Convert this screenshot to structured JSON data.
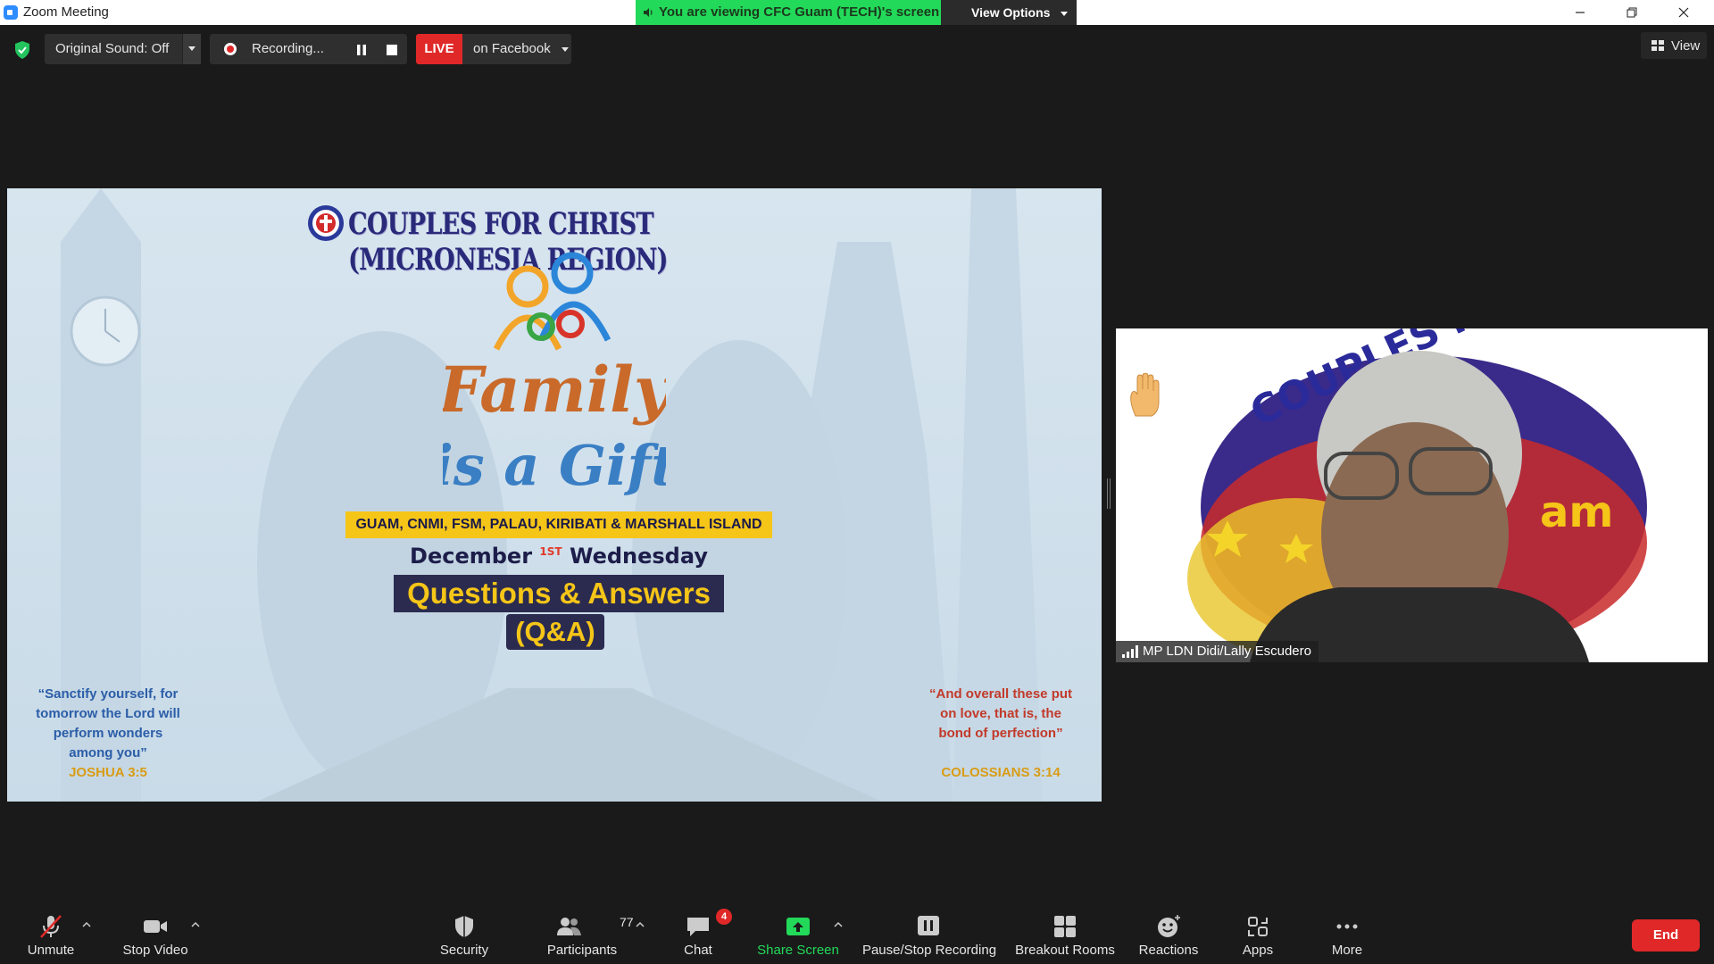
{
  "window": {
    "title": "Zoom Meeting",
    "share_banner": "You are viewing CFC Guam (TECH)'s screen",
    "view_options": "View Options"
  },
  "topbar": {
    "original_sound": "Original Sound: Off",
    "recording": "Recording...",
    "live": "LIVE",
    "live_destination": "on Facebook",
    "view": "View"
  },
  "slide": {
    "org": "COUPLES FOR CHRIST (MICRONESIA REGION)",
    "theme_line1": "Family",
    "theme_line2": "is a Gift",
    "regions": "GUAM, CNMI, FSM, PALAU, KIRIBATI & MARSHALL ISLAND",
    "date_month": "December",
    "date_ord": "1ST",
    "date_day": "Wednesday",
    "qa_title": "Questions & Answers",
    "qa_sub": "(Q&A)",
    "verse_left": "“Sanctify yourself, for tomorrow the Lord will perform wonders among you”",
    "verse_left_ref": "JOSHUA 3:5",
    "verse_right": "“And overall these put on love, that is, the bond of perfection”",
    "verse_right_ref": "COLOSSIANS 3:14"
  },
  "participant": {
    "name": "MP LDN Didi/Lally Escudero",
    "bg_text_top": "COUPLES FOR CHRIST",
    "bg_text_side": "am"
  },
  "toolbar": {
    "unmute": "Unmute",
    "stop_video": "Stop Video",
    "security": "Security",
    "participants": "Participants",
    "participants_count": "77",
    "chat": "Chat",
    "chat_badge": "4",
    "share_screen": "Share Screen",
    "pause_stop_recording": "Pause/Stop Recording",
    "breakout_rooms": "Breakout Rooms",
    "reactions": "Reactions",
    "apps": "Apps",
    "more": "More",
    "end": "End"
  },
  "colors": {
    "share_green": "#23d959",
    "live_red": "#e02828",
    "toolbar_bg": "#1a1a1a"
  }
}
